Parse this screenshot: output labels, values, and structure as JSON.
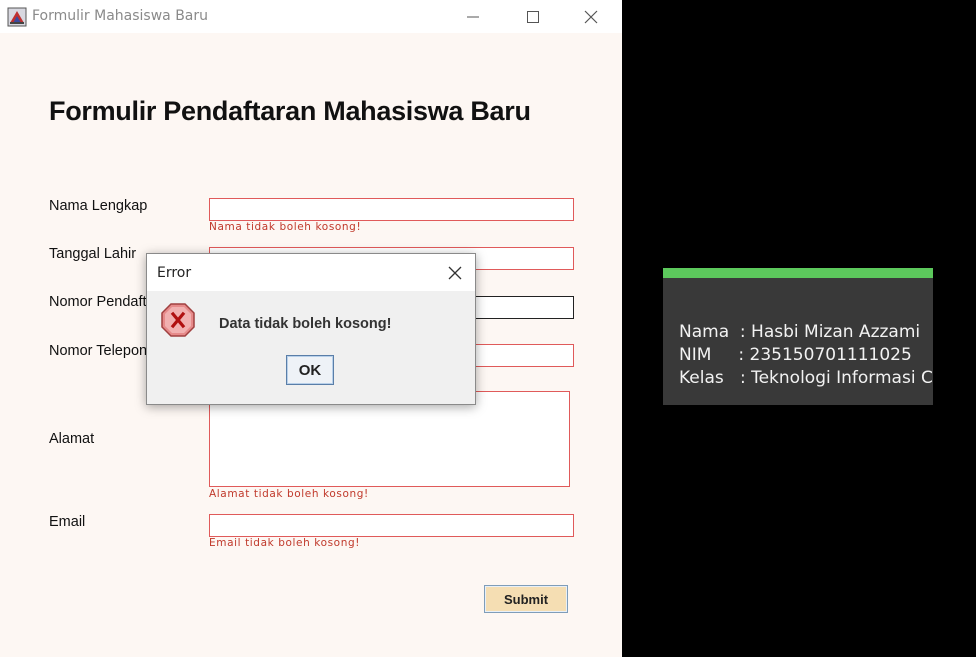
{
  "window": {
    "title": "Formulir Mahasiswa Baru",
    "icons": {
      "app": "java-app-icon",
      "minimize": "minimize-icon",
      "maximize": "maximize-icon",
      "close": "close-icon"
    }
  },
  "form": {
    "heading": "Formulir Pendaftaran Mahasiswa Baru",
    "labels": {
      "nama": "Nama Lengkap",
      "tanggal": "Tanggal Lahir",
      "nomor_pendaftaran": "Nomor Pendaftaran",
      "telepon": "Nomor Telepon",
      "alamat": "Alamat",
      "email": "Email"
    },
    "errors": {
      "nama": "Nama tidak boleh kosong!",
      "alamat": "Alamat tidak boleh kosong!",
      "email": "Email tidak boleh kosong!"
    },
    "values": {
      "nama": "",
      "tanggal": "",
      "nomor_pendaftaran": "",
      "telepon": "",
      "alamat": "",
      "email": ""
    },
    "submit_label": "Submit",
    "colors": {
      "background": "#fdf7f3",
      "error": "#c0392b",
      "error_border": "#e05a5a",
      "submit_bg": "#f5deb3"
    }
  },
  "dialog": {
    "title": "Error",
    "message": "Data tidak boleh kosong!",
    "ok_label": "OK",
    "icons": {
      "error": "error-x-icon",
      "close": "close-icon"
    }
  },
  "info_card": {
    "lines": [
      "Nama  : Hasbi Mizan Azzami",
      "NIM     : 235150701111025",
      "Kelas   : Teknologi Informasi C"
    ],
    "colors": {
      "background": "#393939",
      "accent": "#5cc85c",
      "text": "#f2f2f2"
    }
  }
}
